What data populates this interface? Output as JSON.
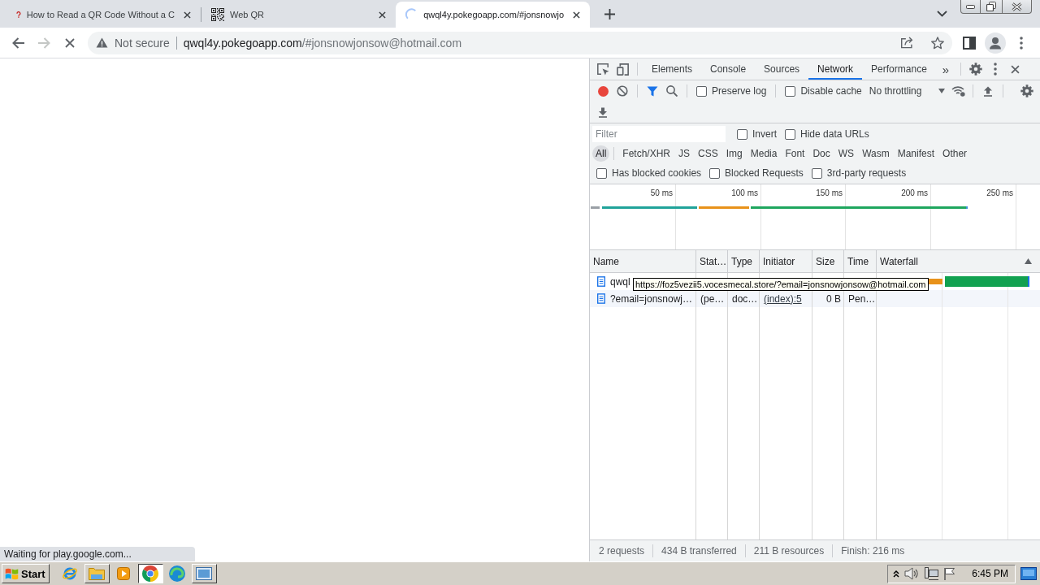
{
  "tabs": [
    {
      "title": "How to Read a QR Code Without a C",
      "kind": "help",
      "selected": false
    },
    {
      "title": "Web QR",
      "kind": "qr",
      "selected": false
    },
    {
      "title": "qwql4y.pokegoapp.com/#jonsnowjo",
      "kind": "loading",
      "selected": true
    }
  ],
  "toolbar": {
    "can_go_forward": false,
    "loading": true,
    "security": "Not secure",
    "url": {
      "host": "qwql4y.pokegoapp.com",
      "path": "/#jonsnowjonsow@hotmail.com"
    }
  },
  "status_bubble": "Waiting for play.google.com...",
  "devtools": {
    "panels": [
      {
        "label": "Elements",
        "selected": false
      },
      {
        "label": "Console",
        "selected": false
      },
      {
        "label": "Sources",
        "selected": false
      },
      {
        "label": "Network",
        "selected": true
      },
      {
        "label": "Performance",
        "selected": false
      }
    ],
    "more": "»",
    "network": {
      "recording": true,
      "options": [
        {
          "label": "Preserve log",
          "checked": false
        },
        {
          "label": "Disable cache",
          "checked": false
        }
      ],
      "throttling": "No throttling",
      "filter": {
        "placeholder": "Filter"
      },
      "filter_options": [
        {
          "label": "Invert",
          "checked": false
        },
        {
          "label": "Hide data URLs",
          "checked": false
        }
      ],
      "types": [
        {
          "label": "All",
          "selected": true
        },
        {
          "label": "Fetch/XHR",
          "selected": false
        },
        {
          "label": "JS",
          "selected": false
        },
        {
          "label": "CSS",
          "selected": false
        },
        {
          "label": "Img",
          "selected": false
        },
        {
          "label": "Media",
          "selected": false
        },
        {
          "label": "Font",
          "selected": false
        },
        {
          "label": "Doc",
          "selected": false
        },
        {
          "label": "WS",
          "selected": false
        },
        {
          "label": "Wasm",
          "selected": false
        },
        {
          "label": "Manifest",
          "selected": false
        },
        {
          "label": "Other",
          "selected": false
        }
      ],
      "request_filters": [
        {
          "label": "Has blocked cookies",
          "checked": false
        },
        {
          "label": "Blocked Requests",
          "checked": false
        },
        {
          "label": "3rd-party requests",
          "checked": false
        }
      ],
      "overview": {
        "ticks": [
          "50 ms",
          "100 ms",
          "150 ms",
          "200 ms",
          "250 ms"
        ]
      },
      "table": {
        "columns": [
          "Name",
          "Stat…",
          "Type",
          "Initiator",
          "Size",
          "Time",
          "Waterfall"
        ],
        "rows": [
          {
            "name": "qwql",
            "waterfall": true
          },
          {
            "name": "?email=jonsnowj…",
            "status": "(pe…",
            "type": "doc…",
            "initiator": "(index):5",
            "size": "0 B",
            "time": "Pen…",
            "waterfall": false
          }
        ]
      },
      "tooltip": "https://foz5vezii5.vocesmecal.store/?email=jonsnowjonsow@hotmail.com",
      "summary": [
        "2 requests",
        "434 B transferred",
        "211 B resources",
        "Finish: 216 ms"
      ]
    }
  },
  "taskbar": {
    "start": "Start",
    "apps": [
      {
        "kind": "globe",
        "running": false,
        "selected": false
      },
      {
        "kind": "folder",
        "running": true,
        "selected": false
      },
      {
        "kind": "player",
        "running": false,
        "selected": false
      },
      {
        "kind": "browser",
        "running": true,
        "selected": true
      },
      {
        "kind": "swirl",
        "running": false,
        "selected": false
      },
      {
        "kind": "screen",
        "running": true,
        "selected": false
      }
    ],
    "clock": "6:45 PM"
  }
}
